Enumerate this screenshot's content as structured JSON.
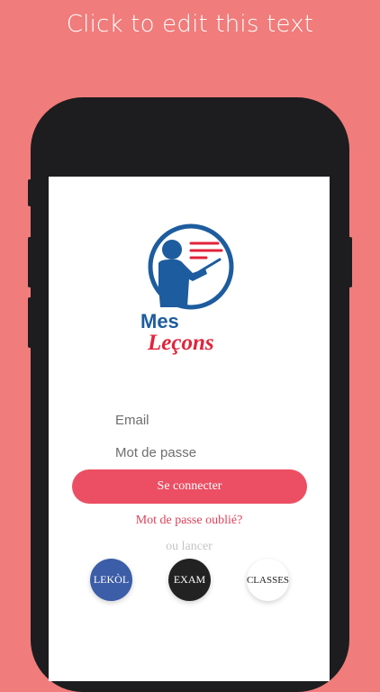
{
  "headline": "Click to edit this text",
  "logo": {
    "line1": "Mes",
    "line2": "Leçons"
  },
  "form": {
    "email_placeholder": "Email",
    "password_placeholder": "Mot de passe",
    "login_label": "Se connecter",
    "forgot_label": "Mot de passe oublié?",
    "or_label": "ou lancer"
  },
  "launch_buttons": [
    {
      "label": "LEKÒL",
      "bg": "#3c5da7",
      "fg": "#ffffff"
    },
    {
      "label": "EXAM",
      "bg": "#222222",
      "fg": "#ffffff"
    },
    {
      "label": "CLASSES",
      "bg": "#ffffff",
      "fg": "#222222"
    }
  ],
  "colors": {
    "background": "#f07c7b",
    "phone_frame": "#1d1d1f",
    "accent": "#ec4f63",
    "logo_blue": "#1d5c9e",
    "logo_red": "#e0243a"
  }
}
